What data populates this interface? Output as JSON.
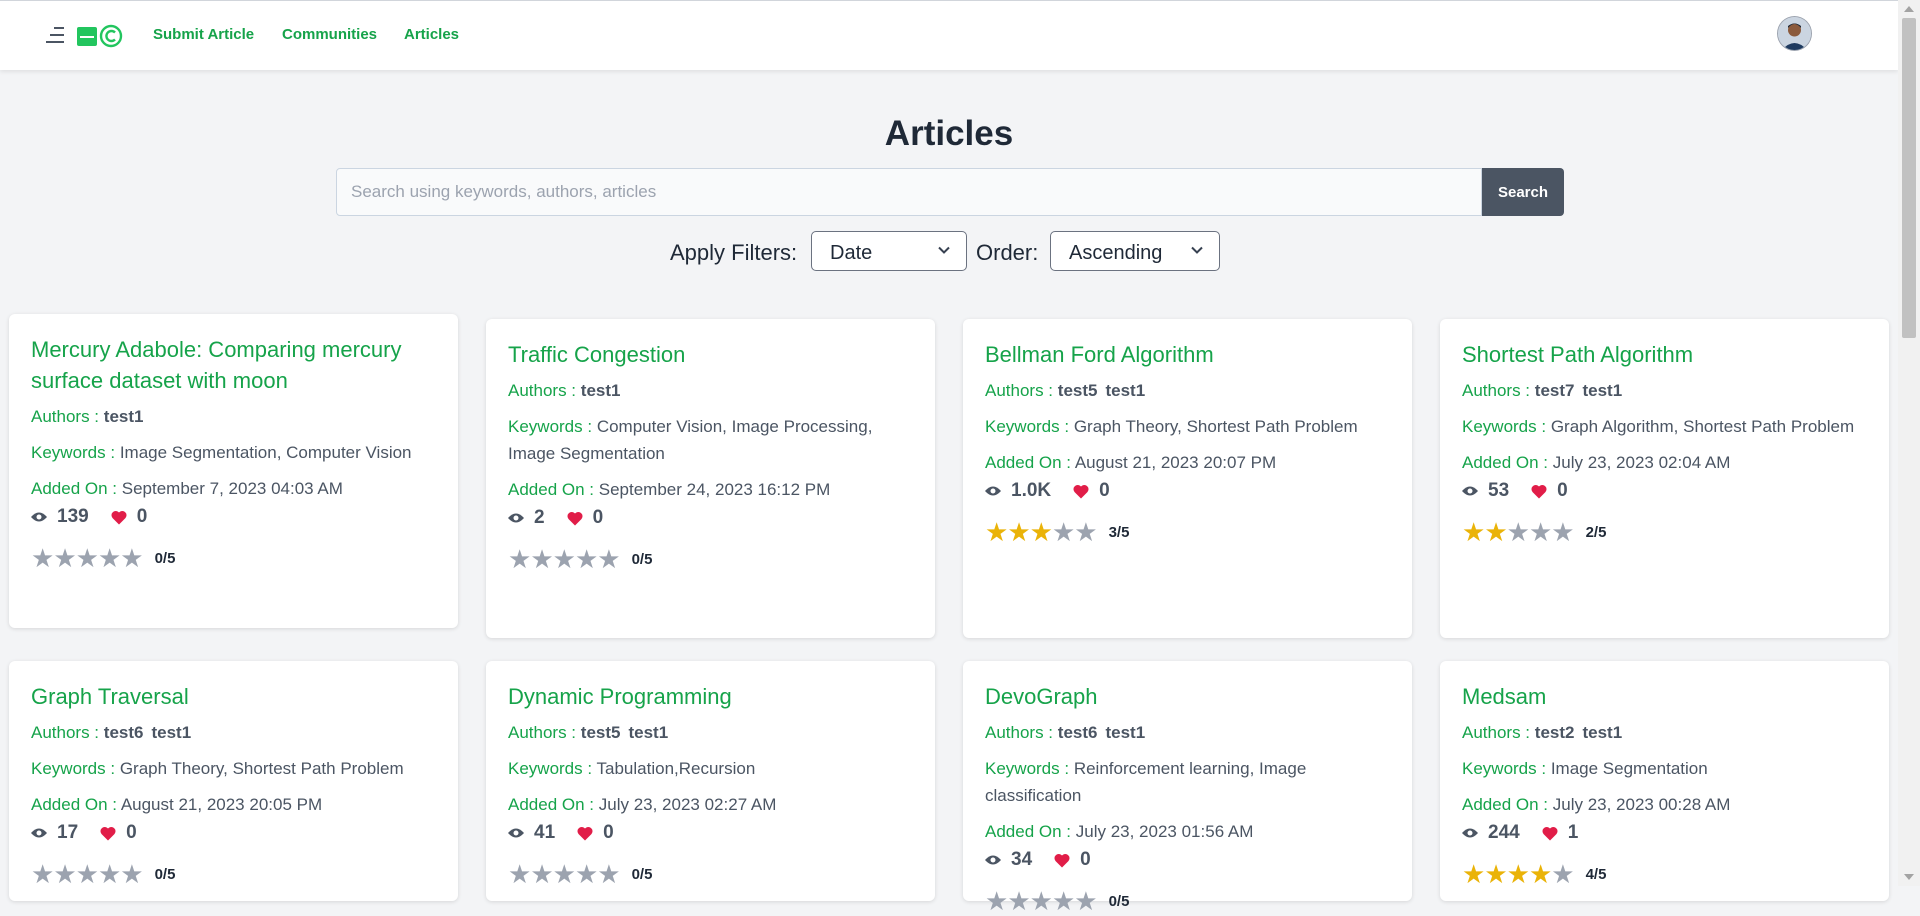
{
  "nav": {
    "links": [
      "Submit Article",
      "Communities",
      "Articles"
    ]
  },
  "page": {
    "title": "Articles"
  },
  "search": {
    "placeholder": "Search using keywords, authors, articles",
    "button_label": "Search"
  },
  "filters": {
    "label": "Apply Filters:",
    "filter_value": "Date",
    "order_label": "Order:",
    "order_value": "Ascending"
  },
  "labels": {
    "authors": "Authors :",
    "keywords": "Keywords :",
    "added_on": "Added On :"
  },
  "colors": {
    "accent": "#16a34a",
    "star": "#eab308",
    "heart": "#e11d48"
  },
  "articles": [
    {
      "title": "Mercury Adabole: Comparing mercury surface dataset with moon",
      "authors": [
        "test1"
      ],
      "keywords": "Image Segmentation, Computer Vision",
      "added_on": "September 7, 2023 04:03 AM",
      "views": "139",
      "likes": "0",
      "rating": 0,
      "rating_text": "0/5"
    },
    {
      "title": "Traffic Congestion",
      "authors": [
        "test1"
      ],
      "keywords": "Computer Vision, Image Processing, Image Segmentation",
      "added_on": "September 24, 2023 16:12 PM",
      "views": "2",
      "likes": "0",
      "rating": 0,
      "rating_text": "0/5"
    },
    {
      "title": "Bellman Ford Algorithm",
      "authors": [
        "test5",
        "test1"
      ],
      "keywords": "Graph Theory, Shortest Path Problem",
      "added_on": "August 21, 2023 20:07 PM",
      "views": "1.0K",
      "likes": "0",
      "rating": 3,
      "rating_text": "3/5"
    },
    {
      "title": "Shortest Path Algorithm",
      "authors": [
        "test7",
        "test1"
      ],
      "keywords": "Graph Algorithm, Shortest Path Problem",
      "added_on": "July 23, 2023 02:04 AM",
      "views": "53",
      "likes": "0",
      "rating": 2,
      "rating_text": "2/5"
    },
    {
      "title": "Graph Traversal",
      "authors": [
        "test6",
        "test1"
      ],
      "keywords": "Graph Theory, Shortest Path Problem",
      "added_on": "August 21, 2023 20:05 PM",
      "views": "17",
      "likes": "0",
      "rating": 0,
      "rating_text": "0/5"
    },
    {
      "title": "Dynamic Programming",
      "authors": [
        "test5",
        "test1"
      ],
      "keywords": "Tabulation,Recursion",
      "added_on": "July 23, 2023 02:27 AM",
      "views": "41",
      "likes": "0",
      "rating": 0,
      "rating_text": "0/5"
    },
    {
      "title": "DevoGraph",
      "authors": [
        "test6",
        "test1"
      ],
      "keywords": "Reinforcement learning, Image classification",
      "added_on": "July 23, 2023 01:56 AM",
      "views": "34",
      "likes": "0",
      "rating": 0,
      "rating_text": "0/5"
    },
    {
      "title": "Medsam",
      "authors": [
        "test2",
        "test1"
      ],
      "keywords": "Image Segmentation",
      "added_on": "July 23, 2023 00:28 AM",
      "views": "244",
      "likes": "1",
      "rating": 4,
      "rating_text": "4/5"
    }
  ]
}
